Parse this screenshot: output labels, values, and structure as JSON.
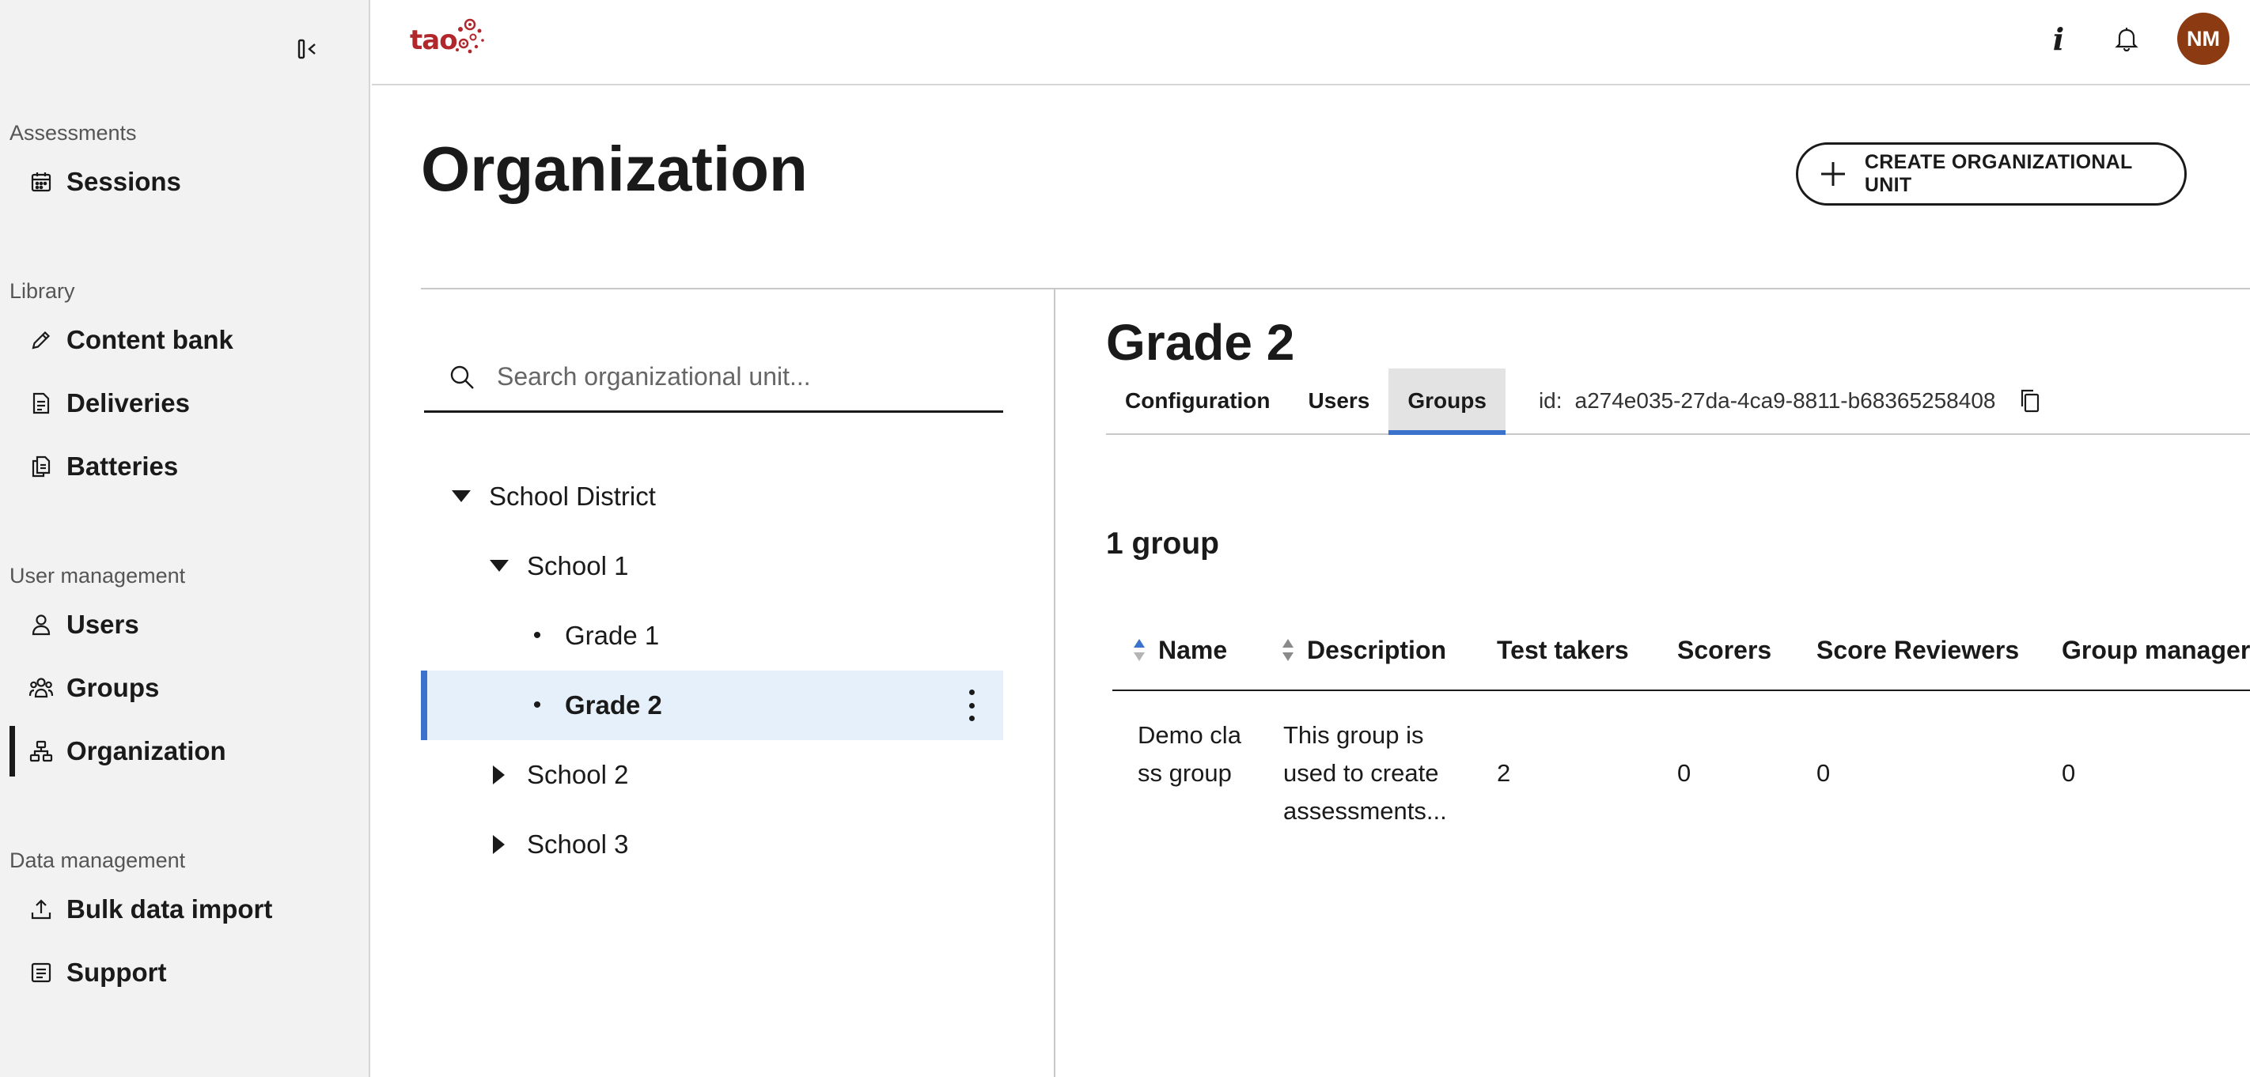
{
  "sidebar": {
    "sections": [
      {
        "label": "Assessments",
        "items": [
          {
            "label": "Sessions",
            "icon": "calendar-icon"
          }
        ]
      },
      {
        "label": "Library",
        "items": [
          {
            "label": "Content bank",
            "icon": "pencil-icon"
          },
          {
            "label": "Deliveries",
            "icon": "document-list-icon"
          },
          {
            "label": "Batteries",
            "icon": "document-stack-icon"
          }
        ]
      },
      {
        "label": "User management",
        "items": [
          {
            "label": "Users",
            "icon": "user-icon"
          },
          {
            "label": "Groups",
            "icon": "users-icon"
          },
          {
            "label": "Organization",
            "icon": "org-chart-icon",
            "active": true
          }
        ]
      },
      {
        "label": "Data management",
        "items": [
          {
            "label": "Bulk data import",
            "icon": "upload-icon"
          },
          {
            "label": "Support",
            "icon": "support-document-icon"
          }
        ]
      }
    ]
  },
  "topbar": {
    "logo_text": "tao",
    "info_glyph": "i",
    "avatar_initials": "NM"
  },
  "page": {
    "title": "Organization",
    "create_button_label": "CREATE ORGANIZATIONAL UNIT"
  },
  "search": {
    "placeholder": "Search organizational unit...",
    "value": ""
  },
  "tree": [
    {
      "label": "School District",
      "level": 0,
      "state": "expanded"
    },
    {
      "label": "School 1",
      "level": 1,
      "state": "expanded"
    },
    {
      "label": "Grade 1",
      "level": 2,
      "state": "leaf"
    },
    {
      "label": "Grade 2",
      "level": 2,
      "state": "leaf",
      "selected": true
    },
    {
      "label": "School 2",
      "level": 1,
      "state": "collapsed"
    },
    {
      "label": "School 3",
      "level": 1,
      "state": "collapsed"
    }
  ],
  "detail": {
    "title": "Grade 2",
    "tabs": [
      "Configuration",
      "Users",
      "Groups"
    ],
    "active_tab": "Groups",
    "id_label": "id:",
    "id_value": "a274e035-27da-4ca9-8811-b68365258408",
    "group_count": "1 group",
    "table": {
      "columns": [
        "Name",
        "Description",
        "Test takers",
        "Scorers",
        "Score Reviewers",
        "Group managers"
      ],
      "rows": [
        {
          "name": "Demo class group",
          "description": "This group is used to create assessments...",
          "test_takers": "2",
          "scorers": "0",
          "score_reviewers": "0",
          "group_managers": "0"
        }
      ]
    }
  },
  "colors": {
    "accent": "#3a72cc",
    "selected_bg": "#e6f0fb",
    "avatar_bg": "#8b3a12",
    "logo": "#b0282c",
    "sidebar_bg": "#f2f2f2"
  }
}
